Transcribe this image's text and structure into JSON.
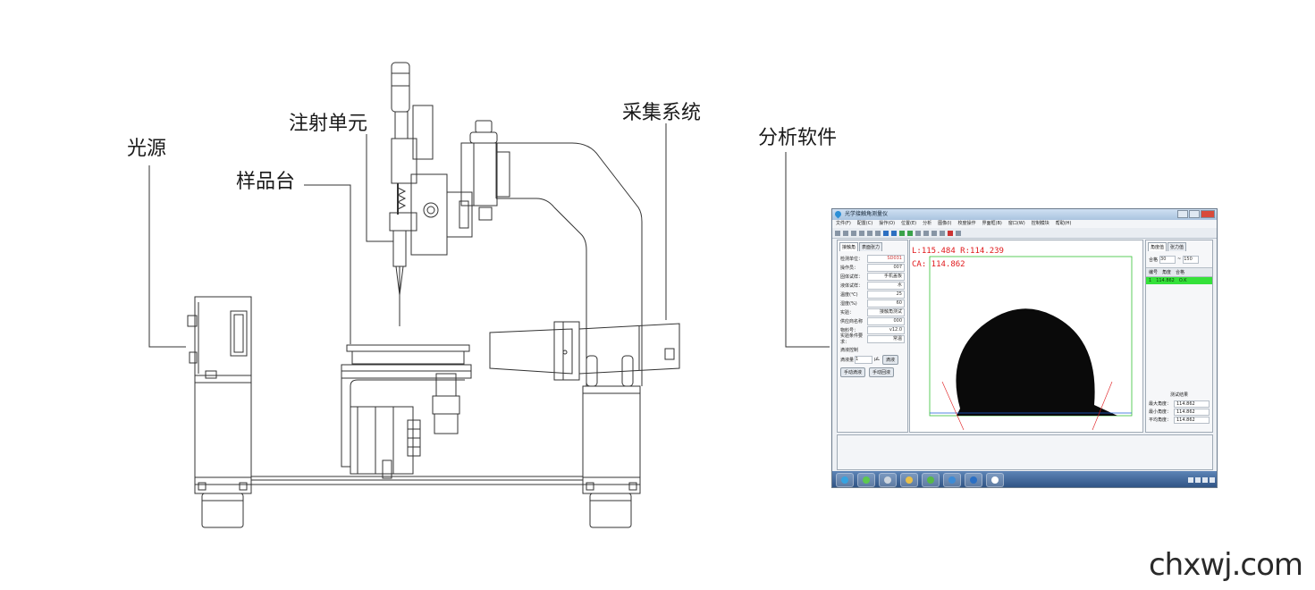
{
  "callouts": {
    "light_source": "光源",
    "sample_stage": "样品台",
    "injection_unit": "注射单元",
    "acquisition_system": "采集系统",
    "analysis_software": "分析软件"
  },
  "watermark": "chxwj.com",
  "software": {
    "title": "光学接触角测量仪",
    "menu": [
      "文件(F)",
      "配置(C)",
      "操作(O)",
      "位置(E)",
      "分析",
      "图像(I)",
      "校度操作",
      "界面框(B)",
      "窗口(W)",
      "控制模块",
      "帮助(H)"
    ],
    "left_tabs": [
      "接触角",
      "表面张力"
    ],
    "fields": [
      {
        "label": "检测单位：",
        "value": "SD031",
        "highlight": true
      },
      {
        "label": "操作员：",
        "value": "007",
        "highlight": false
      },
      {
        "label": "固体试样：",
        "value": "手机盖板",
        "highlight": false
      },
      {
        "label": "液体试样：",
        "value": "水",
        "highlight": false
      },
      {
        "label": "温度(℃)",
        "value": "25",
        "highlight": false
      },
      {
        "label": "湿度(%)",
        "value": "60",
        "highlight": false
      },
      {
        "label": "实验：",
        "value": "接触角测试",
        "highlight": false
      },
      {
        "label": "供应商名称",
        "value": "000",
        "highlight": false
      },
      {
        "label": "物料号：",
        "value": "v12.0",
        "highlight": false
      },
      {
        "label": "实验条件要求：",
        "value": "常温",
        "highlight": false
      }
    ],
    "drip_section": "滴液控制",
    "drip_label": "滴液量",
    "drip_value": "1",
    "drip_unit": "μL",
    "drip_button": "滴液",
    "manual_drip": "手动滴液",
    "manual_retract": "手动回液",
    "overlay_line1": "L:115.484  R:114.239",
    "overlay_line2": "CA: 114.862",
    "right_tabs": [
      "角度值",
      "张力值"
    ],
    "range_label": "合格",
    "range_min": "30",
    "range_sep": "~",
    "range_max": "150",
    "grid_headers": [
      "编号",
      "角度",
      "合格"
    ],
    "grid_row": [
      "1",
      "114.862",
      "O.K"
    ],
    "results_title": "测试结果",
    "results": [
      {
        "label": "最大角度：",
        "value": "114.862"
      },
      {
        "label": "最小角度：",
        "value": "114.862"
      },
      {
        "label": "平均角度：",
        "value": "114.862"
      }
    ]
  }
}
